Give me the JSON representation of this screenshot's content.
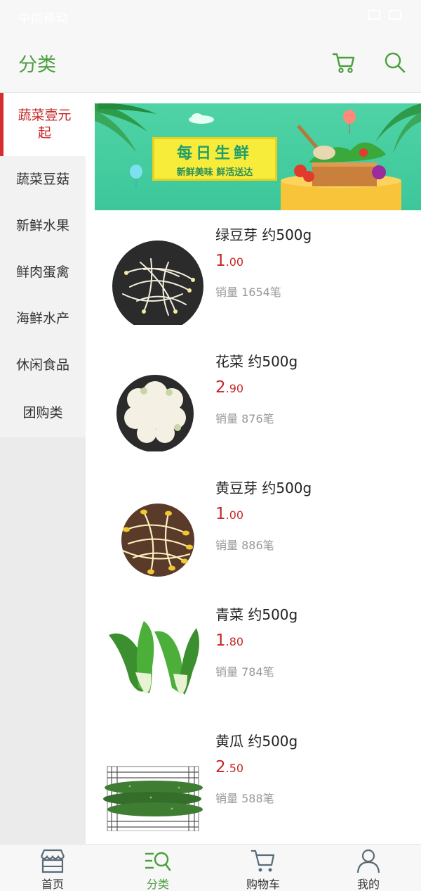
{
  "status_bar": {
    "text": "中国移动"
  },
  "header": {
    "title": "分类"
  },
  "colors": {
    "accent_green": "#4a9e3e",
    "price_red": "#c62828",
    "active_red": "#d32f2f"
  },
  "sidebar": {
    "items": [
      {
        "label": "蔬菜壹元起",
        "active": true
      },
      {
        "label": "蔬菜豆菇",
        "active": false
      },
      {
        "label": "新鲜水果",
        "active": false
      },
      {
        "label": "鲜肉蛋禽",
        "active": false
      },
      {
        "label": "海鲜水产",
        "active": false
      },
      {
        "label": "休闲食品",
        "active": false
      },
      {
        "label": "团购类",
        "active": false
      }
    ]
  },
  "banner": {
    "title": "每日生鲜",
    "subtitle": "新鲜美味 鲜活送达"
  },
  "products": [
    {
      "name": "绿豆芽 约500g",
      "price_int": "1",
      "price_dec": ".00",
      "sales": "销量 1654笔",
      "icon": "bean-sprouts-plate-icon"
    },
    {
      "name": "花菜 约500g",
      "price_int": "2",
      "price_dec": ".90",
      "sales": "销量 876笔",
      "icon": "cauliflower-icon"
    },
    {
      "name": "黄豆芽 约500g",
      "price_int": "1",
      "price_dec": ".00",
      "sales": "销量 886笔",
      "icon": "soybean-sprouts-bowl-icon"
    },
    {
      "name": "青菜 约500g",
      "price_int": "1",
      "price_dec": ".80",
      "sales": "销量 784笔",
      "icon": "bok-choy-icon"
    },
    {
      "name": "黄瓜 约500g",
      "price_int": "2",
      "price_dec": ".50",
      "sales": "销量 588笔",
      "icon": "cucumber-icon"
    }
  ],
  "bottom_nav": {
    "items": [
      {
        "label": "首页",
        "icon": "store-icon",
        "active": false
      },
      {
        "label": "分类",
        "icon": "category-search-icon",
        "active": true
      },
      {
        "label": "购物车",
        "icon": "cart-icon",
        "active": false
      },
      {
        "label": "我的",
        "icon": "profile-icon",
        "active": false
      }
    ]
  }
}
